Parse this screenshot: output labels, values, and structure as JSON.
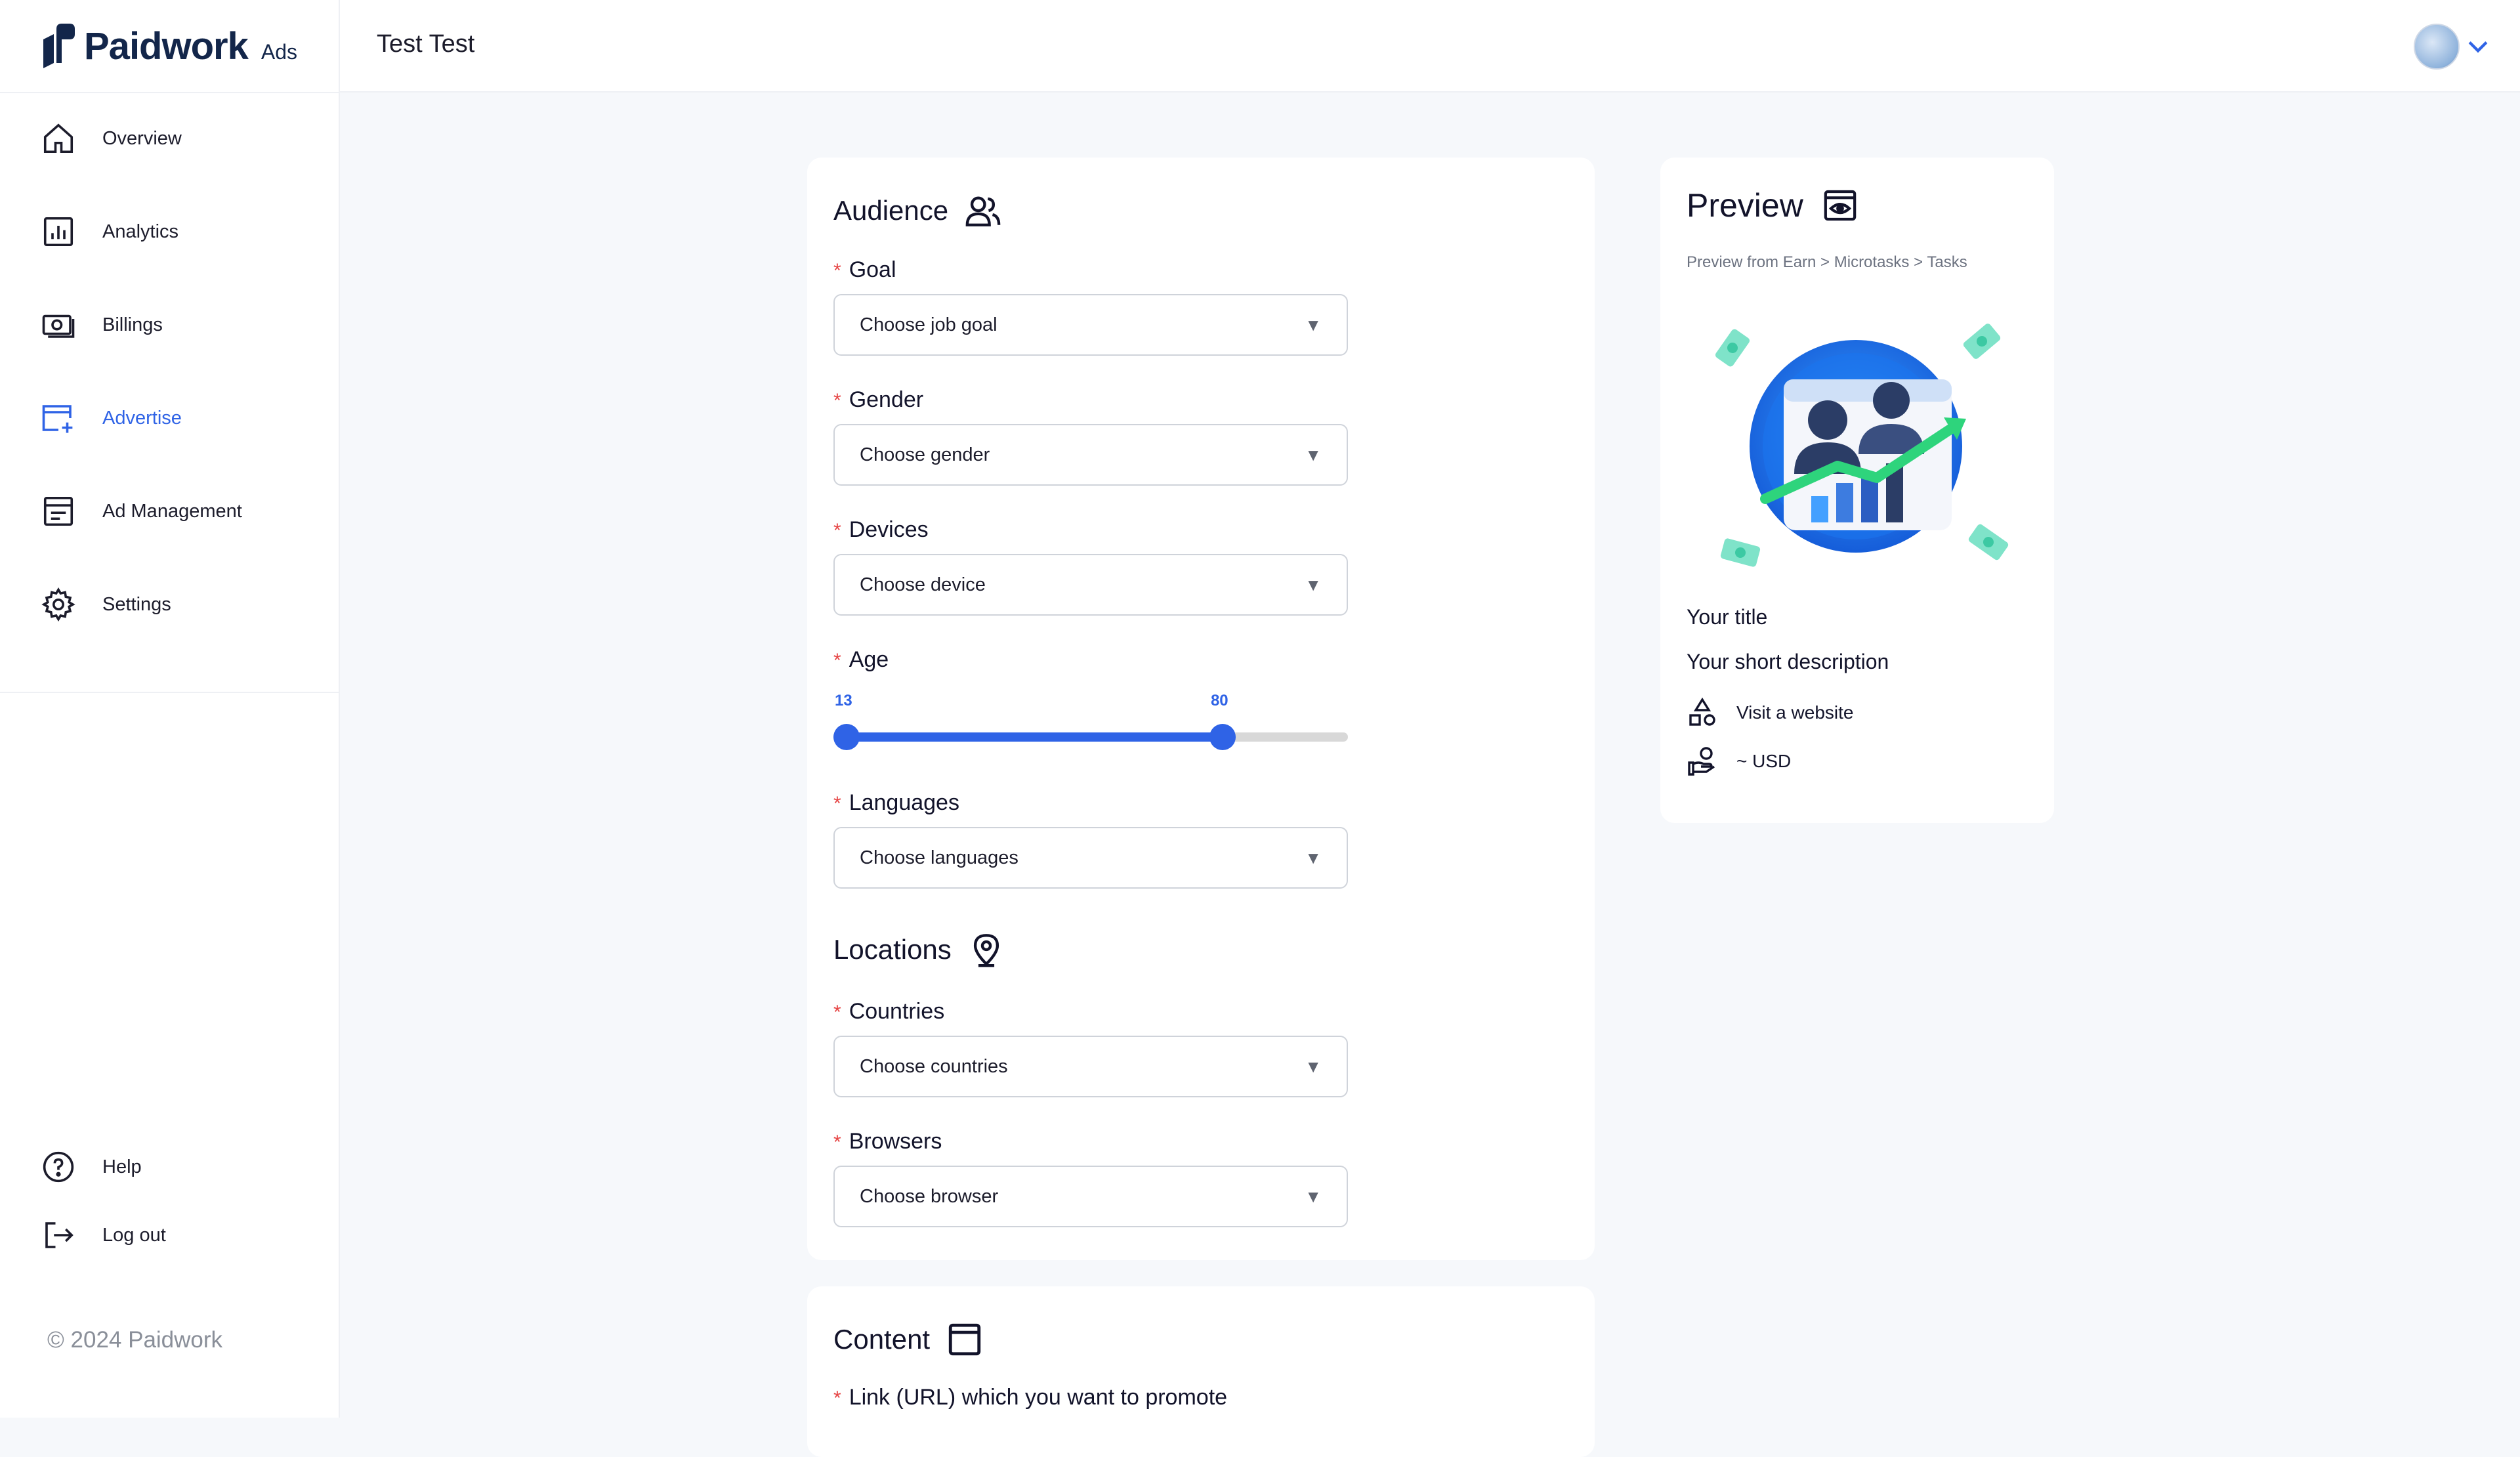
{
  "app": {
    "brand": "Paidwork",
    "brand_suffix": "Ads",
    "header_title": "Test Test",
    "copyright": "© 2024 Paidwork"
  },
  "sidebar": {
    "items": [
      {
        "label": "Overview",
        "icon": "home-icon"
      },
      {
        "label": "Analytics",
        "icon": "analytics-icon"
      },
      {
        "label": "Billings",
        "icon": "billing-icon"
      },
      {
        "label": "Advertise",
        "icon": "advertise-icon",
        "active": true
      },
      {
        "label": "Ad Management",
        "icon": "ad-management-icon"
      },
      {
        "label": "Settings",
        "icon": "gear-icon"
      }
    ],
    "bottom": [
      {
        "label": "Help",
        "icon": "help-icon"
      },
      {
        "label": "Log out",
        "icon": "logout-icon"
      }
    ]
  },
  "audience": {
    "title": "Audience",
    "goal": {
      "label": "Goal",
      "placeholder": "Choose job goal"
    },
    "gender": {
      "label": "Gender",
      "placeholder": "Choose gender"
    },
    "devices": {
      "label": "Devices",
      "placeholder": "Choose device"
    },
    "age": {
      "label": "Age",
      "min": 13,
      "max": 80,
      "range_min": 13,
      "range_max": 100
    },
    "languages": {
      "label": "Languages",
      "placeholder": "Choose languages"
    }
  },
  "locations": {
    "title": "Locations",
    "countries": {
      "label": "Countries",
      "placeholder": "Choose countries"
    },
    "browsers": {
      "label": "Browsers",
      "placeholder": "Choose browser"
    }
  },
  "content": {
    "title": "Content",
    "link_label": "Link (URL) which you want to promote"
  },
  "preview": {
    "title": "Preview",
    "breadcrumb": "Preview from Earn > Microtasks > Tasks",
    "your_title": "Your title",
    "your_description": "Your short description",
    "action": "Visit a website",
    "reward": "~ USD"
  },
  "colors": {
    "accent": "#2f63e6",
    "required": "#e64545"
  }
}
